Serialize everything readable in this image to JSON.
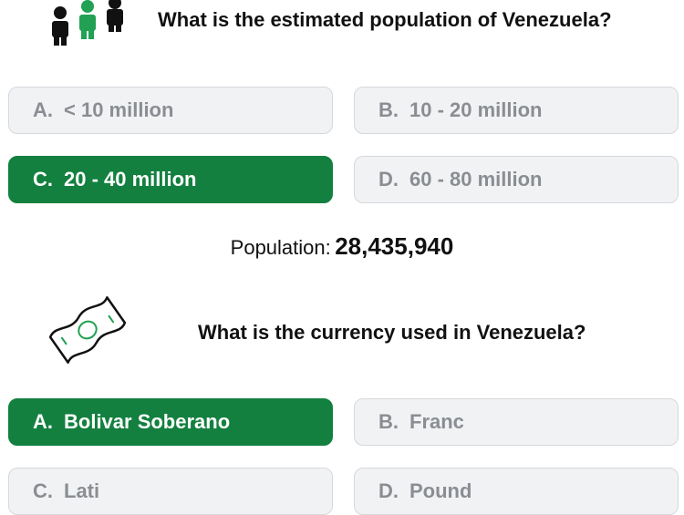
{
  "q1": {
    "icon": "people-icon",
    "question": "What is the estimated population of Venezuela?",
    "options": [
      {
        "letter": "A.",
        "text": "< 10 million",
        "state": "neutral"
      },
      {
        "letter": "B.",
        "text": "10 - 20 million",
        "state": "neutral"
      },
      {
        "letter": "C.",
        "text": "20 - 40 million",
        "state": "correct"
      },
      {
        "letter": "D.",
        "text": "60 - 80 million",
        "state": "neutral"
      }
    ]
  },
  "population": {
    "label": "Population:",
    "value": "28,435,940"
  },
  "q2": {
    "icon": "banknote-icon",
    "question": "What is the currency used in Venezuela?",
    "options": [
      {
        "letter": "A.",
        "text": "Bolivar Soberano",
        "state": "correct"
      },
      {
        "letter": "B.",
        "text": "Franc",
        "state": "neutral"
      },
      {
        "letter": "C.",
        "text": "Lati",
        "state": "neutral"
      },
      {
        "letter": "D.",
        "text": "Pound",
        "state": "neutral"
      }
    ]
  },
  "colors": {
    "correct": "#13803f",
    "neutral_bg": "#f1f2f4",
    "neutral_text": "#8a8d92"
  }
}
